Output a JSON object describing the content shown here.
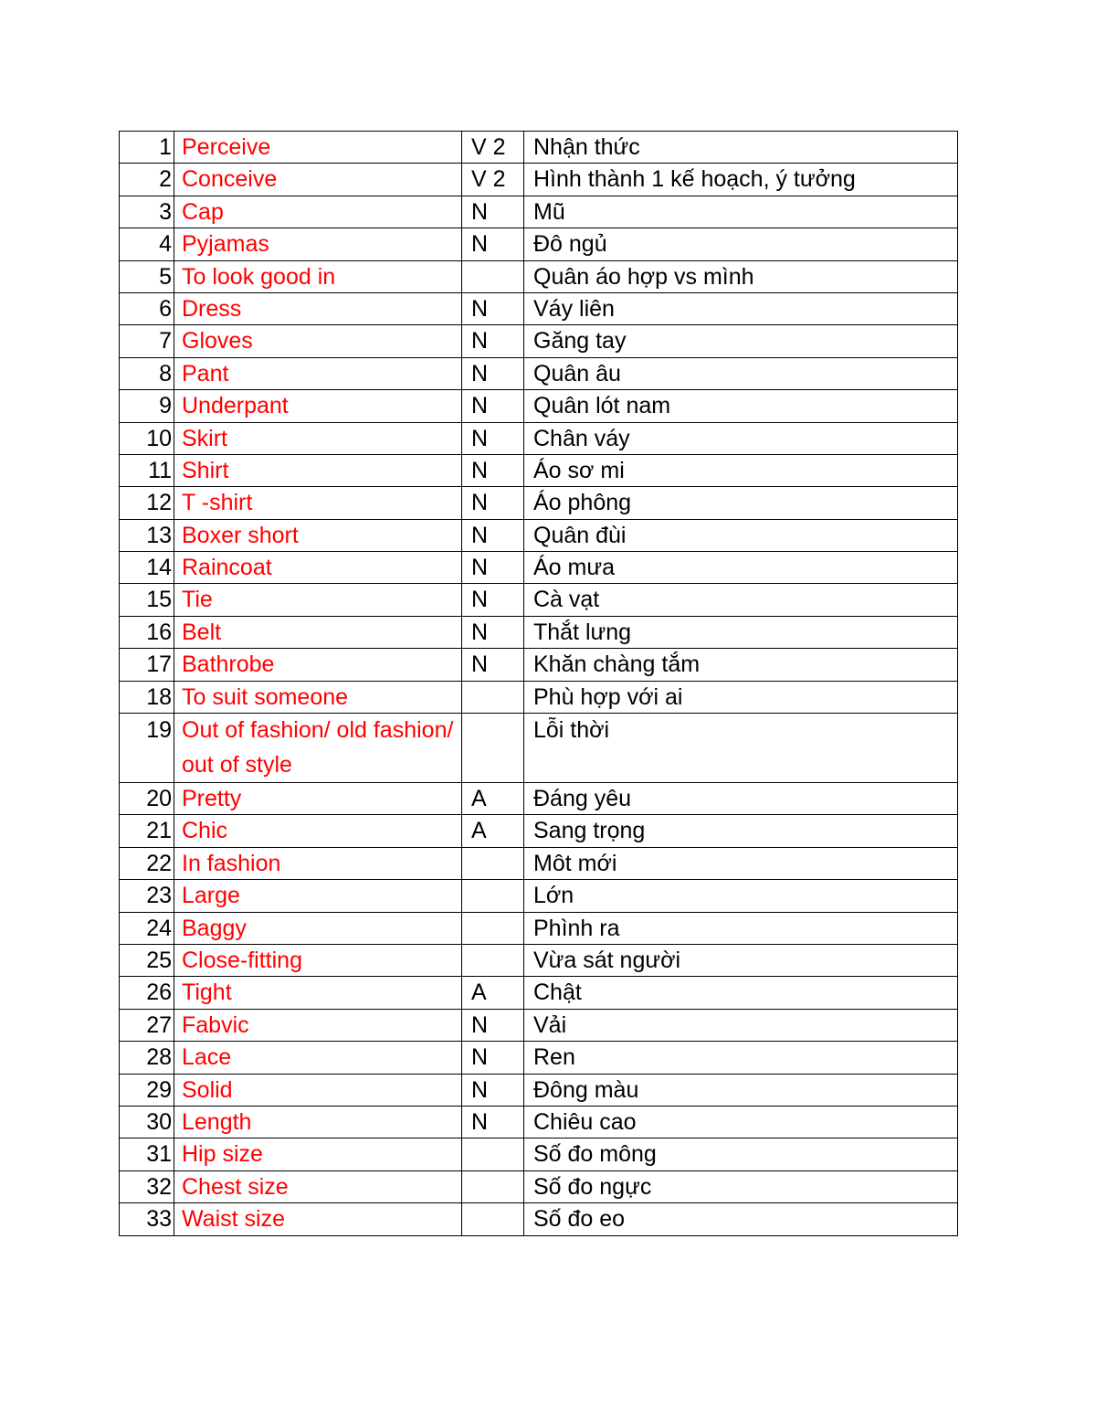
{
  "document": {
    "type": "vocabulary-table",
    "accent_color": "#FF0000",
    "text_color": "#000000",
    "border_color": "#000000",
    "background_color": "#FFFFFF"
  },
  "table": {
    "columns": [
      "number",
      "term",
      "part_of_speech",
      "meaning"
    ],
    "rows": [
      {
        "number": "1.",
        "term": "Perceive",
        "pos": "V 2",
        "meaning": "Nhận thức"
      },
      {
        "number": "2.",
        "term": "Conceive",
        "pos": "V 2",
        "meaning": "Hình thành 1 kế hoạch, ý tưởng"
      },
      {
        "number": "3.",
        "term": "Cap",
        "pos": "N",
        "meaning": "Mũ"
      },
      {
        "number": "4.",
        "term": "Pyjamas",
        "pos": "N",
        "meaning": "Đô ngủ"
      },
      {
        "number": "5.",
        "term": "To look good in",
        "pos": "",
        "meaning": "Quân áo hợp vs mình"
      },
      {
        "number": "6.",
        "term": "Dress",
        "pos": "N",
        "meaning": "Váy liên"
      },
      {
        "number": "7.",
        "term": "Gloves",
        "pos": "N",
        "meaning": "Găng tay"
      },
      {
        "number": "8.",
        "term": "Pant",
        "pos": "N",
        "meaning": "Quân âu"
      },
      {
        "number": "9.",
        "term": "Underpant",
        "pos": "N",
        "meaning": "Quân lót nam"
      },
      {
        "number": "10.",
        "term": "Skirt",
        "pos": "N",
        "meaning": "Chân váy"
      },
      {
        "number": "11.",
        "term": "Shirt",
        "pos": "N",
        "meaning": "Áo sơ mi"
      },
      {
        "number": "12.",
        "term": "T -shirt",
        "pos": "N",
        "meaning": "Áo phông"
      },
      {
        "number": "13.",
        "term": "Boxer short",
        "pos": "N",
        "meaning": "Quân đùi"
      },
      {
        "number": "14.",
        "term": "Raincoat",
        "pos": "N",
        "meaning": "Áo mưa"
      },
      {
        "number": "15.",
        "term": "Tie",
        "pos": "N",
        "meaning": "Cà vạt"
      },
      {
        "number": "16.",
        "term": "Belt",
        "pos": "N",
        "meaning": "Thắt lưng"
      },
      {
        "number": "17.",
        "term": "Bathrobe",
        "pos": "N",
        "meaning": "Khăn chàng tắm"
      },
      {
        "number": "18.",
        "term": "To suit someone",
        "pos": "",
        "meaning": "Phù hợp với ai"
      },
      {
        "number": "19.",
        "term": "Out of fashion/ old fashion/ out of style",
        "pos": "",
        "meaning": "Lỗi thời",
        "tall": true
      },
      {
        "number": "20.",
        "term": "Pretty",
        "pos": "A",
        "meaning": "Đáng yêu"
      },
      {
        "number": "21.",
        "term": "Chic",
        "pos": "A",
        "meaning": "Sang trọng"
      },
      {
        "number": "22.",
        "term": "In fashion",
        "pos": "",
        "meaning": "Môt mới"
      },
      {
        "number": "23.",
        "term": "Large",
        "pos": "",
        "meaning": "Lớn"
      },
      {
        "number": "24.",
        "term": "Baggy",
        "pos": "",
        "meaning": "Phình ra"
      },
      {
        "number": "25.",
        "term": "Close-fitting",
        "pos": "",
        "meaning": "Vừa sát người"
      },
      {
        "number": "26.",
        "term": "Tight",
        "pos": "A",
        "meaning": "Chật"
      },
      {
        "number": "27.",
        "term": "Fabvic",
        "pos": "N",
        "meaning": "Vải"
      },
      {
        "number": "28.",
        "term": "Lace",
        "pos": "N",
        "meaning": "Ren"
      },
      {
        "number": "29.",
        "term": "Solid",
        "pos": "N",
        "meaning": "Đông màu"
      },
      {
        "number": "30.",
        "term": "Length",
        "pos": "N",
        "meaning": "Chiêu cao"
      },
      {
        "number": "31.",
        "term": "Hip size",
        "pos": "",
        "meaning": "Số đo mông"
      },
      {
        "number": "32.",
        "term": "Chest size",
        "pos": "",
        "meaning": "Số đo ngực"
      },
      {
        "number": "33.",
        "term": "Waist size",
        "pos": "",
        "meaning": "Số đo eo"
      }
    ]
  }
}
